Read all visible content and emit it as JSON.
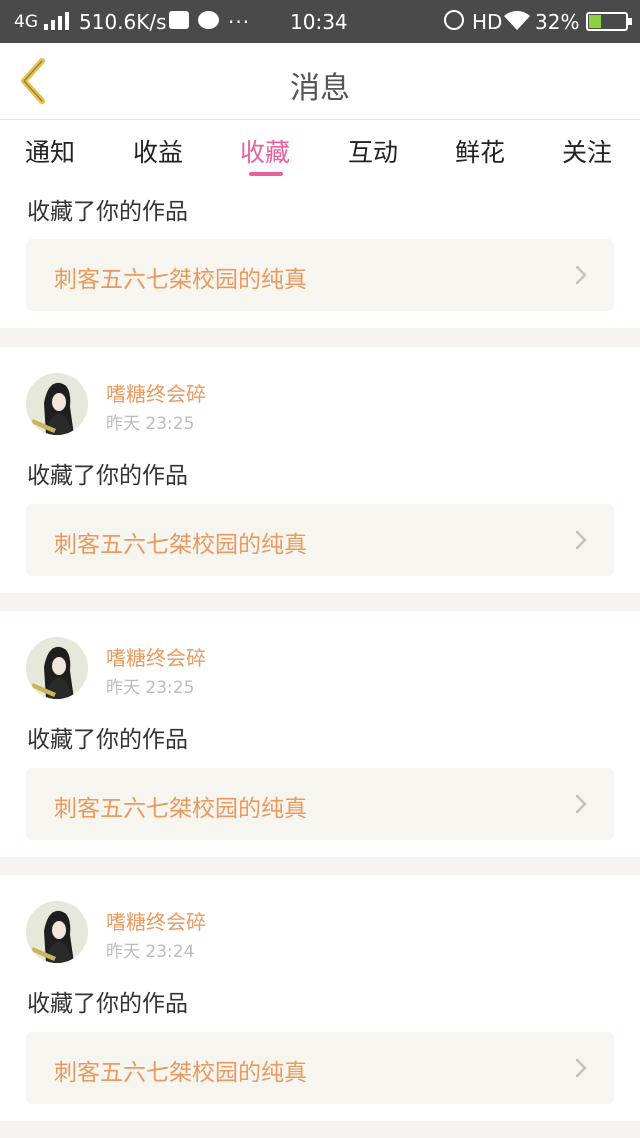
{
  "status_bar": {
    "network": "4G",
    "speed": "510.6K/s",
    "dots": "···",
    "time": "10:34",
    "hd": "HD",
    "battery_percent": "32%",
    "battery_level": 0.32,
    "battery_color": "#8bd13a"
  },
  "nav": {
    "title": "消息",
    "back_icon": "chevron-left-icon",
    "back_color": "#e6c24a"
  },
  "tabs": [
    {
      "label": "通知"
    },
    {
      "label": "收益"
    },
    {
      "label": "收藏",
      "active": true
    },
    {
      "label": "互动"
    },
    {
      "label": "鲜花"
    },
    {
      "label": "关注"
    }
  ],
  "accent_color": "#e8619b",
  "name_color": "#eb9a5e",
  "feed": [
    {
      "action": "收藏了你的作品",
      "work_title": "刺客五六七桀校园的纯真"
    },
    {
      "user": "嗜糖终会碎",
      "time": "昨天 23:25",
      "action": "收藏了你的作品",
      "work_title": "刺客五六七桀校园的纯真"
    },
    {
      "user": "嗜糖终会碎",
      "time": "昨天 23:25",
      "action": "收藏了你的作品",
      "work_title": "刺客五六七桀校园的纯真"
    },
    {
      "user": "嗜糖终会碎",
      "time": "昨天 23:24",
      "action": "收藏了你的作品",
      "work_title": "刺客五六七桀校园的纯真"
    }
  ]
}
